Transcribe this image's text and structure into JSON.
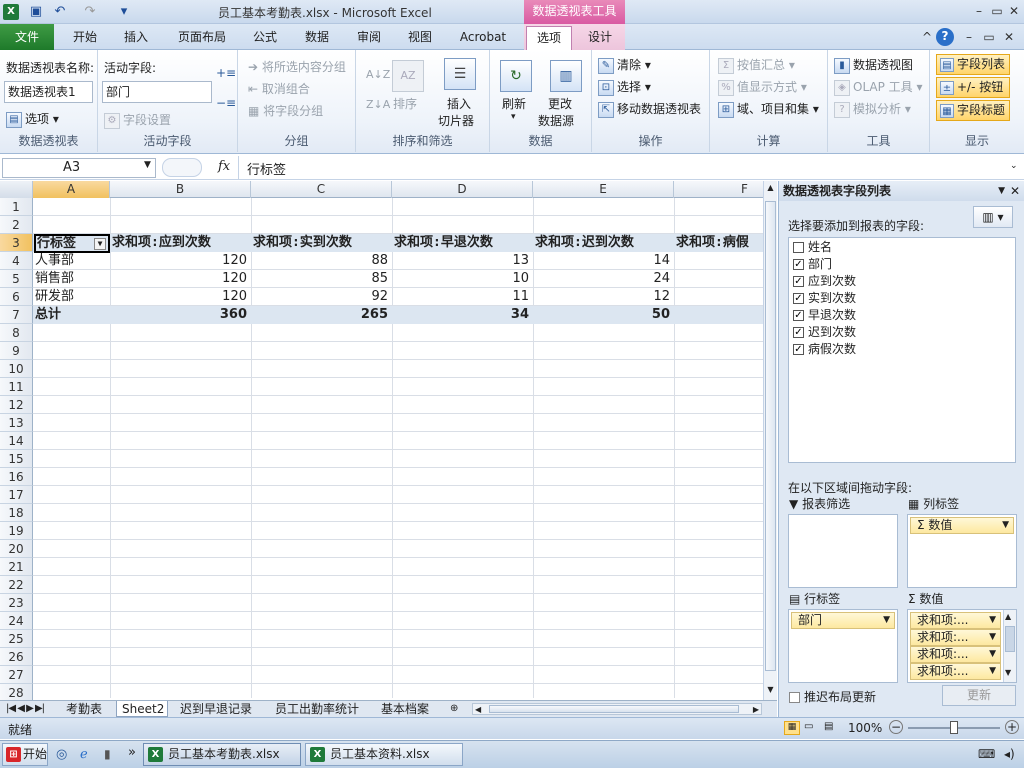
{
  "window": {
    "title": "员工基本考勤表.xlsx - Microsoft Excel",
    "context_tab_title": "数据透视表工具"
  },
  "tabs": {
    "file": "文件",
    "items": [
      "开始",
      "插入",
      "页面布局",
      "公式",
      "数据",
      "审阅",
      "视图",
      "Acrobat",
      "选项",
      "设计"
    ],
    "active": "选项"
  },
  "ribbon": {
    "pivot": {
      "name_label": "数据透视表名称:",
      "name_value": "数据透视表1",
      "options": "选项",
      "group": "数据透视表"
    },
    "active_field": {
      "label": "活动字段:",
      "value": "部门",
      "field_settings": "字段设置",
      "group": "活动字段"
    },
    "grouping": {
      "group_selection": "将所选内容分组",
      "ungroup": "取消组合",
      "group_field": "将字段分组",
      "group": "分组"
    },
    "sort": {
      "sort": "排序",
      "insert_slicer_1": "插入",
      "insert_slicer_2": "切片器",
      "group": "排序和筛选"
    },
    "data": {
      "refresh": "刷新",
      "change_source_1": "更改",
      "change_source_2": "数据源",
      "group": "数据"
    },
    "actions": {
      "clear": "清除",
      "select": "选择",
      "move": "移动数据透视表",
      "group": "操作"
    },
    "calc": {
      "summarize_by": "按值汇总",
      "show_values_as": "值显示方式",
      "fields_items_sets": "域、项目和集",
      "group": "计算"
    },
    "tools": {
      "pivot_chart": "数据透视图",
      "olap": "OLAP 工具",
      "what_if": "模拟分析",
      "group": "工具"
    },
    "show": {
      "field_list": "字段列表",
      "buttons": "+/- 按钮",
      "headers": "字段标题",
      "group": "显示"
    }
  },
  "formula_bar": {
    "name_box": "A3",
    "fx": "fx",
    "content": "行标签"
  },
  "sheet": {
    "columns": [
      "A",
      "B",
      "C",
      "D",
      "E",
      "F"
    ],
    "rows": [
      "1",
      "2",
      "3",
      "4",
      "5",
      "6",
      "7",
      "8",
      "9",
      "10",
      "11",
      "12",
      "13",
      "14",
      "15",
      "16",
      "17",
      "18",
      "19",
      "20",
      "21",
      "22",
      "23",
      "24",
      "25",
      "26",
      "27",
      "28"
    ],
    "pivot": {
      "headers": [
        "行标签",
        "求和项:应到次数",
        "求和项:实到次数",
        "求和项:早退次数",
        "求和项:迟到次数",
        "求和项:病假"
      ],
      "body": [
        [
          "人事部",
          "120",
          "88",
          "13",
          "14"
        ],
        [
          "销售部",
          "120",
          "85",
          "10",
          "24"
        ],
        [
          "研发部",
          "120",
          "92",
          "11",
          "12"
        ]
      ],
      "total": [
        "总计",
        "360",
        "265",
        "34",
        "50"
      ]
    }
  },
  "sheet_tabs": [
    "考勤表",
    "Sheet2",
    "迟到早退记录",
    "员工出勤率统计",
    "基本档案"
  ],
  "active_sheet": "Sheet2",
  "status": {
    "ready": "就绪",
    "zoom": "100%"
  },
  "pane": {
    "title": "数据透视表字段列表",
    "choose_label": "选择要添加到报表的字段:",
    "fields": [
      {
        "name": "姓名",
        "checked": false
      },
      {
        "name": "部门",
        "checked": true
      },
      {
        "name": "应到次数",
        "checked": true
      },
      {
        "name": "实到次数",
        "checked": true
      },
      {
        "name": "早退次数",
        "checked": true
      },
      {
        "name": "迟到次数",
        "checked": true
      },
      {
        "name": "病假次数",
        "checked": true
      }
    ],
    "drag_label": "在以下区域间拖动字段:",
    "filter_label": "报表筛选",
    "column_label": "列标签",
    "column_items": [
      "Σ 数值"
    ],
    "row_label": "行标签",
    "row_items": [
      "部门"
    ],
    "values_label": "数值",
    "values_items": [
      "求和项:...",
      "求和项:...",
      "求和项:...",
      "求和项:..."
    ],
    "defer": "推迟布局更新",
    "update": "更新"
  },
  "taskbar": {
    "start": "开始",
    "items": [
      "员工基本考勤表.xlsx",
      "员工基本资料.xlsx"
    ]
  }
}
